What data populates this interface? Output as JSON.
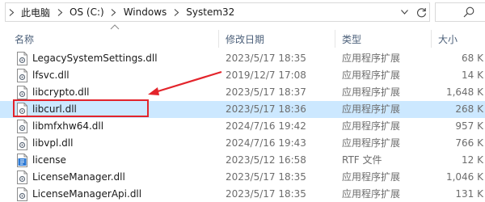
{
  "breadcrumb": {
    "items": [
      "此电脑",
      "OS (C:)",
      "Windows",
      "System32"
    ]
  },
  "columns": {
    "name": "名称",
    "date": "修改日期",
    "type": "类型",
    "size": "大小"
  },
  "files": [
    {
      "name": "LegacySystemSettings.dll",
      "date": "2023/5/17 18:35",
      "type": "应用程序扩展",
      "size": "68 K",
      "icon": "dll-file-icon"
    },
    {
      "name": "lfsvc.dll",
      "date": "2019/12/7 17:08",
      "type": "应用程序扩展",
      "size": "14 K",
      "icon": "dll-file-icon"
    },
    {
      "name": "libcrypto.dll",
      "date": "2023/5/17 18:37",
      "type": "应用程序扩展",
      "size": "1,648 K",
      "icon": "dll-file-icon"
    },
    {
      "name": "libcurl.dll",
      "date": "2023/5/17 18:36",
      "type": "应用程序扩展",
      "size": "268 K",
      "icon": "dll-file-icon"
    },
    {
      "name": "libmfxhw64.dll",
      "date": "2024/7/16 19:42",
      "type": "应用程序扩展",
      "size": "957 K",
      "icon": "dll-file-icon"
    },
    {
      "name": "libvpl.dll",
      "date": "2024/7/16 19:43",
      "type": "应用程序扩展",
      "size": "766 K",
      "icon": "dll-file-icon"
    },
    {
      "name": "license",
      "date": "2023/5/12 16:58",
      "type": "RTF 文件",
      "size": "12 K",
      "icon": "rtf-file-icon"
    },
    {
      "name": "LicenseManager.dll",
      "date": "2023/5/17 18:35",
      "type": "应用程序扩展",
      "size": "1,046 K",
      "icon": "dll-file-icon"
    },
    {
      "name": "LicenseManagerApi.dll",
      "date": "2023/5/17 18:35",
      "type": "应用程序扩展",
      "size": "131 K",
      "icon": "dll-file-icon"
    }
  ],
  "selected_index": 3,
  "colors": {
    "selected_row": "#cce8ff",
    "annotation_red": "#e3242b",
    "header_text": "#4c607a"
  }
}
